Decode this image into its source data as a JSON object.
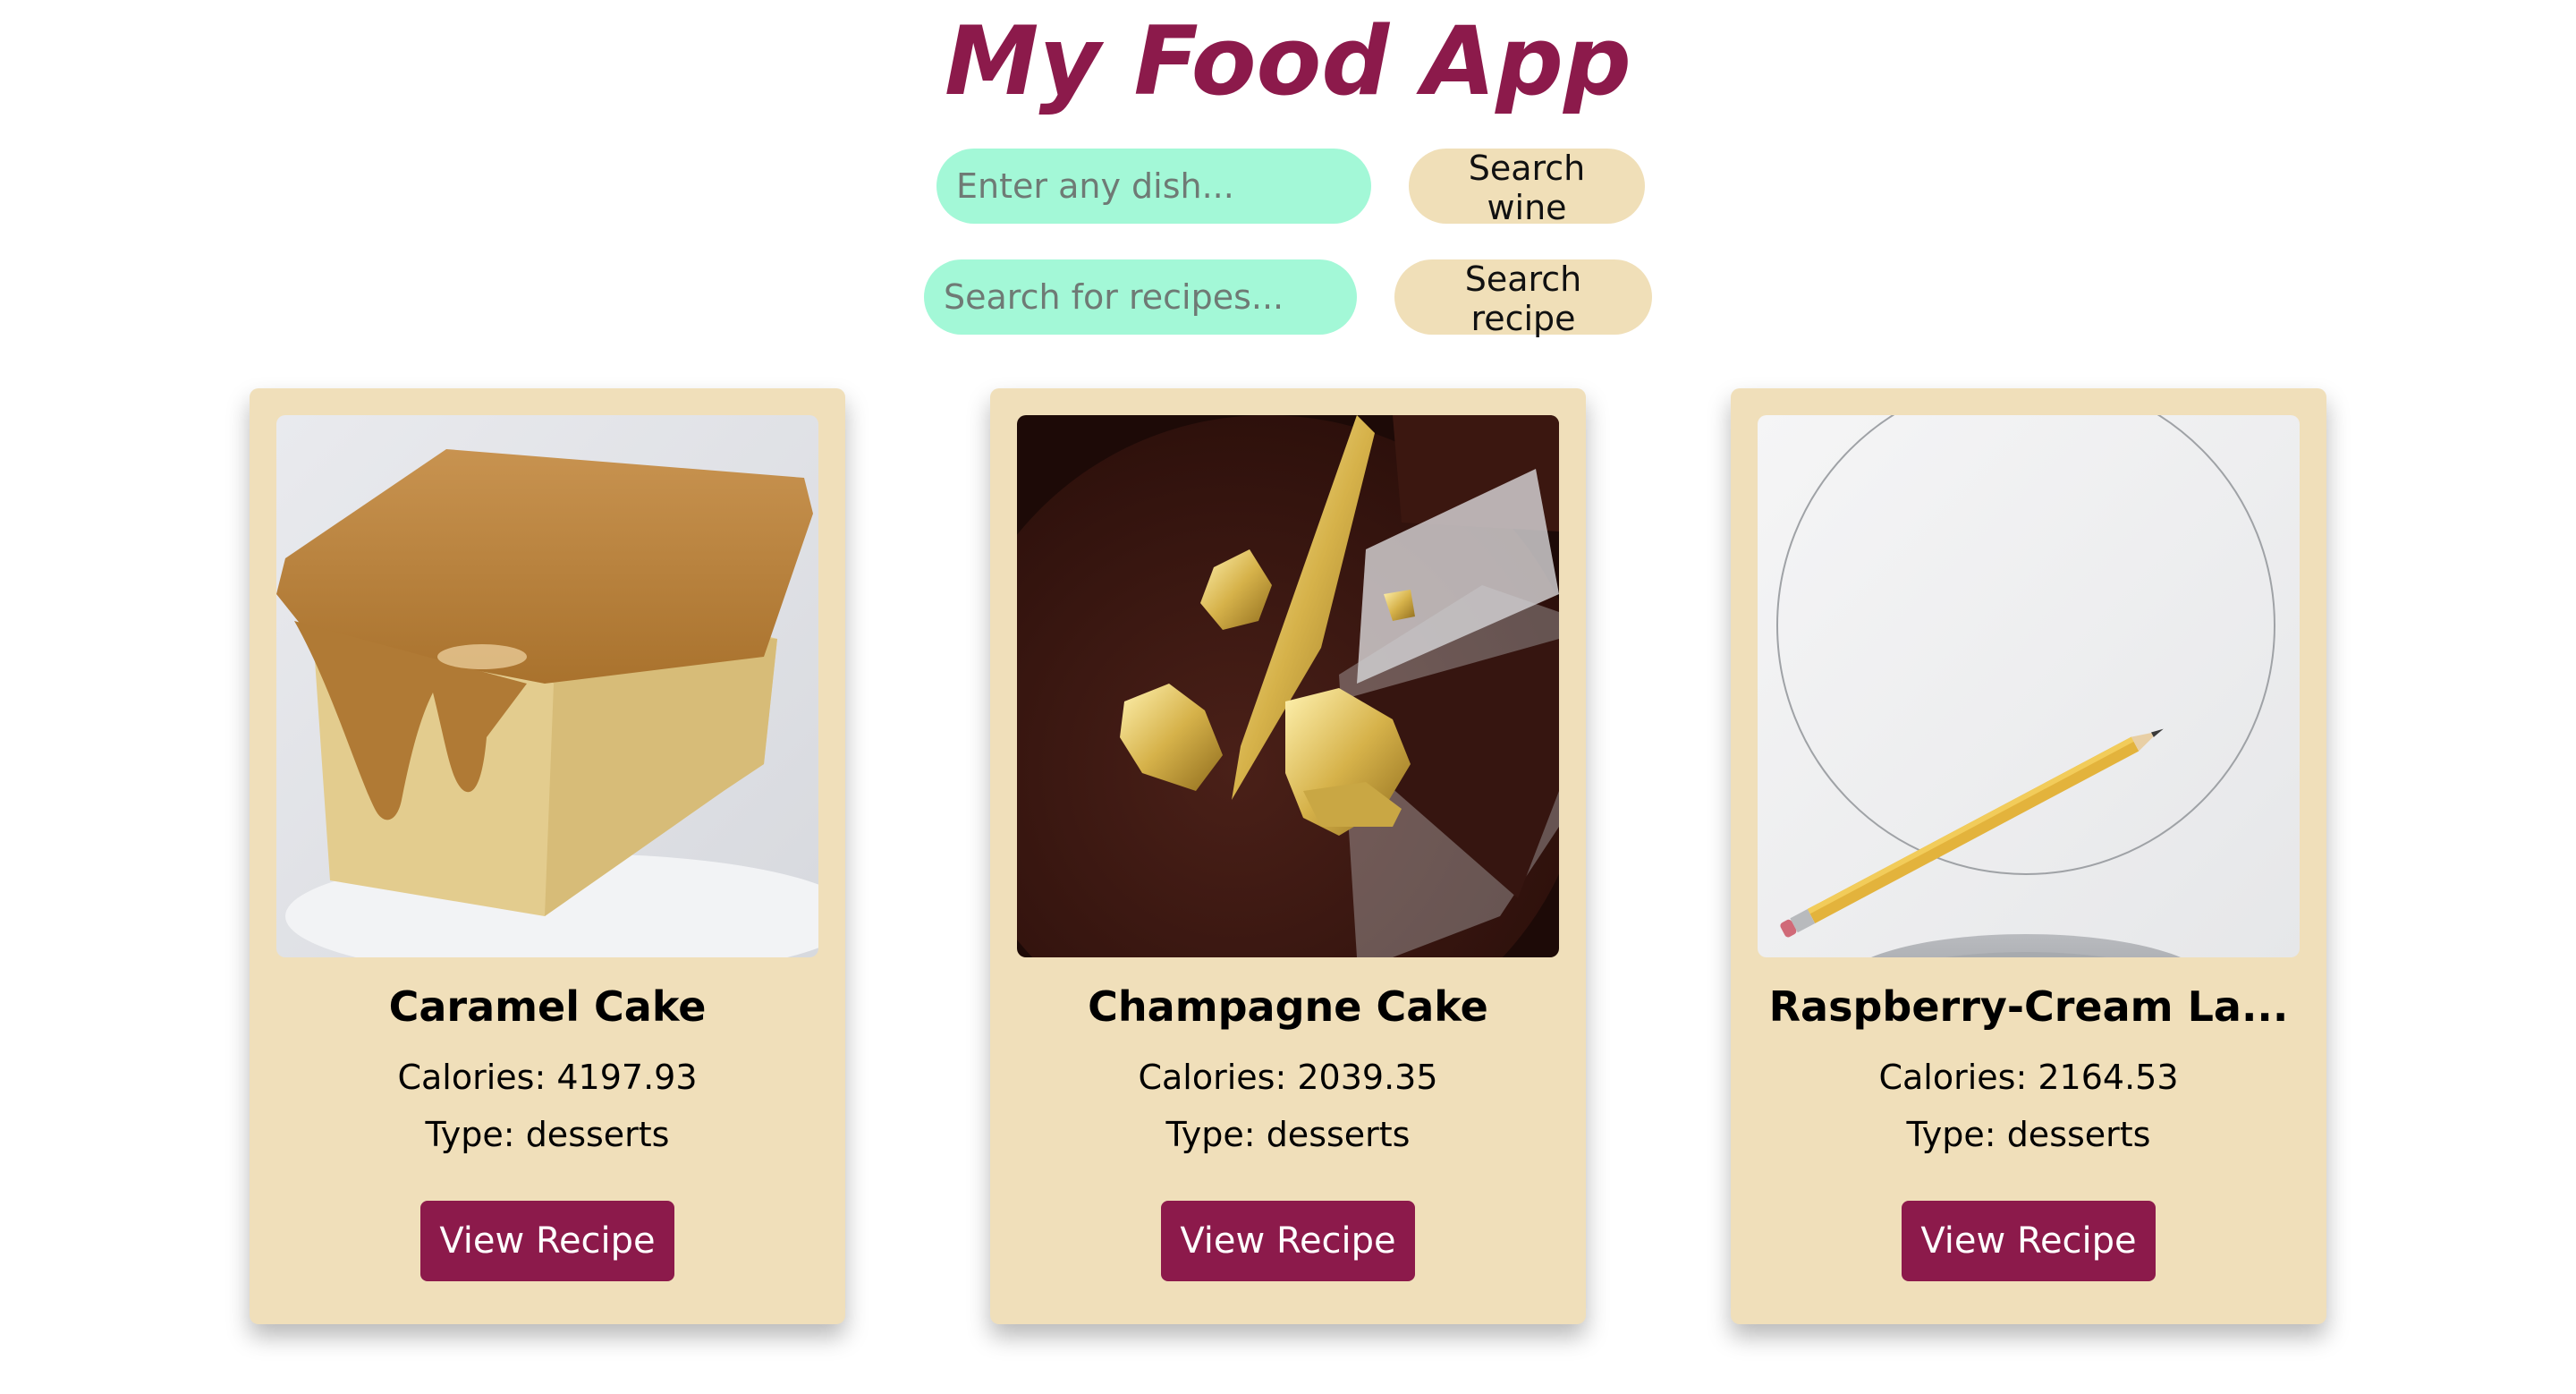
{
  "app": {
    "title": "My Food App"
  },
  "wine_search": {
    "placeholder": "Enter any dish...",
    "value": "",
    "button_label": "Search wine"
  },
  "recipe_search": {
    "placeholder": "Search for recipes...",
    "value": "",
    "button_label": "Search recipe"
  },
  "recipes": [
    {
      "title": "Caramel Cake",
      "calories_label": "Calories:",
      "calories": "4197.93",
      "type_label": "Type:",
      "type": "desserts",
      "button_label": "View Recipe"
    },
    {
      "title": "Champagne Cake",
      "calories_label": "Calories:",
      "calories": "2039.35",
      "type_label": "Type:",
      "type": "desserts",
      "button_label": "View Recipe"
    },
    {
      "title": "Raspberry-Cream La...",
      "calories_label": "Calories:",
      "calories": "2164.53",
      "type_label": "Type:",
      "type": "desserts",
      "button_label": "View Recipe"
    }
  ],
  "colors": {
    "accent": "#8c1a4b",
    "input_bg": "#a3f8d7",
    "button_bg": "#f0dfb8",
    "card_bg": "#f0dfba"
  }
}
